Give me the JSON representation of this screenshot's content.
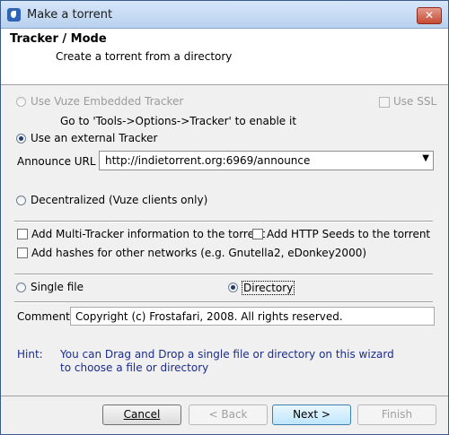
{
  "window": {
    "title": "Make a torrent",
    "close_glyph": "✕"
  },
  "header": {
    "title": "Tracker / Mode",
    "subtitle": "Create a torrent from a directory"
  },
  "tracker": {
    "embedded_label": "Use Vuze Embedded Tracker",
    "ssl_label": "Use SSL",
    "embedded_note": "Go to 'Tools->Options->Tracker' to enable it",
    "external_label": "Use an external Tracker",
    "announce_label": "Announce URL :",
    "announce_value": "http://indietorrent.org:6969/announce",
    "announce_arrow": "▼",
    "decentralized_label": "Decentralized (Vuze clients only)"
  },
  "options": {
    "multi_tracker_label": "Add Multi-Tracker information to the torrent",
    "http_seeds_label": "Add HTTP Seeds to the torrent",
    "hashes_label": "Add hashes for other networks (e.g. Gnutella2, eDonkey2000)"
  },
  "mode": {
    "single_file_label": "Single file",
    "directory_label": "Directory",
    "selected": "Directory"
  },
  "comment": {
    "label": "Comment",
    "value": "Copyright (c) Frostafari, 2008. All rights reserved."
  },
  "hint": {
    "label": "Hint:",
    "line1": "You can Drag and Drop a single file or directory on this wizard",
    "line2": "to choose a file or directory"
  },
  "buttons": {
    "cancel": "Cancel",
    "back": "< Back",
    "next": "Next >",
    "finish": "Finish"
  },
  "colors": {
    "hint_text": "#1c2c8c",
    "title_gradient_top": "#d6e6fa",
    "close_button": "#c44b32"
  }
}
